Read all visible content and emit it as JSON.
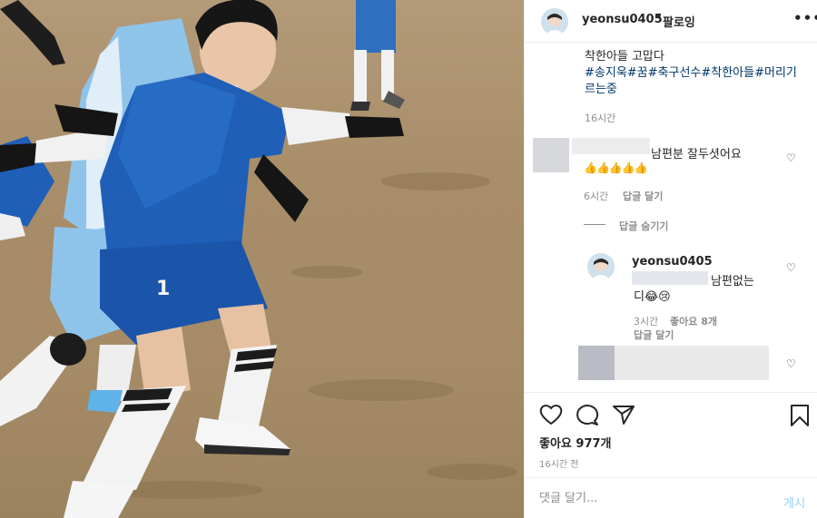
{
  "header": {
    "username": "yeonsu0405",
    "separator": "•",
    "follow_label": "팔로잉",
    "more_icon": "more-icon"
  },
  "caption": {
    "cut_text": "착한아들 고맙다",
    "hashtags": "#송지욱#꿈#축구선수#착한아들#머리기르는중",
    "time": "16시간"
  },
  "comments": [
    {
      "text": "남편분 잘두셧어요",
      "emoji": "👍👍👍👍👍",
      "time": "6시간",
      "reply_label": "답글 달기",
      "hide_replies_label": "답글 숨기기"
    },
    {
      "username": "yeonsu0405",
      "text_line1": "남편없는",
      "text_line2": "디😂😢",
      "time": "3시간",
      "likes": "좋아요 8개",
      "reply_label": "답글 달기"
    }
  ],
  "actions": {
    "icons": [
      "heart-icon",
      "comment-icon",
      "share-icon",
      "bookmark-icon"
    ],
    "likes": "좋아요 977개",
    "time_ago": "16시간 전"
  },
  "comment_box": {
    "placeholder": "댓글 달기...",
    "post_label": "게시"
  },
  "colors": {
    "hashtag": "#00376b",
    "muted": "#8e8e8e",
    "post_disabled": "#b2dffc",
    "jersey_blue": "#1f5fb8",
    "sky_jersey": "#8fc4ea"
  }
}
